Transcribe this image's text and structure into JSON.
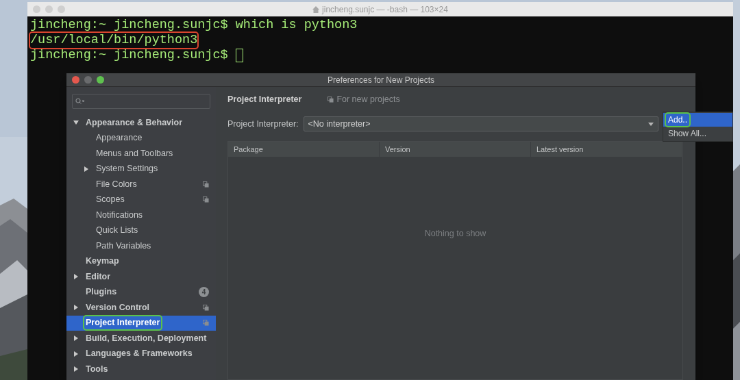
{
  "terminal": {
    "title": "jincheng.sunjc — -bash — 103×24",
    "lines": [
      {
        "text": "jincheng:~ jincheng.sunjc$ which is python3",
        "boxed": false,
        "cursor": false
      },
      {
        "text": "/usr/local/bin/python3",
        "boxed": true,
        "cursor": false
      },
      {
        "text": "jincheng:~ jincheng.sunjc$ ",
        "boxed": false,
        "cursor": true
      }
    ]
  },
  "dialog": {
    "title": "Preferences for New Projects",
    "sidebar": {
      "items": [
        {
          "label": "Appearance & Behavior",
          "expanded": true,
          "selected": false,
          "boxed": false,
          "shared": false,
          "children": [
            {
              "label": "Appearance",
              "selected": false,
              "boxed": false,
              "shared": false
            },
            {
              "label": "Menus and Toolbars",
              "selected": false,
              "boxed": false,
              "shared": false
            },
            {
              "label": "System Settings",
              "expanded": false,
              "selected": false,
              "boxed": false,
              "shared": false
            },
            {
              "label": "File Colors",
              "selected": false,
              "boxed": false,
              "shared": true
            },
            {
              "label": "Scopes",
              "selected": false,
              "boxed": false,
              "shared": true
            },
            {
              "label": "Notifications",
              "selected": false,
              "boxed": false,
              "shared": false
            },
            {
              "label": "Quick Lists",
              "selected": false,
              "boxed": false,
              "shared": false
            },
            {
              "label": "Path Variables",
              "selected": false,
              "boxed": false,
              "shared": false
            }
          ]
        },
        {
          "label": "Keymap",
          "selected": false,
          "boxed": false,
          "shared": false
        },
        {
          "label": "Editor",
          "expanded": false,
          "selected": false,
          "boxed": false,
          "shared": false
        },
        {
          "label": "Plugins",
          "selected": false,
          "boxed": false,
          "shared": false,
          "badge": "4"
        },
        {
          "label": "Version Control",
          "expanded": false,
          "selected": false,
          "boxed": false,
          "shared": true
        },
        {
          "label": "Project Interpreter",
          "selected": true,
          "boxed": true,
          "shared": true
        },
        {
          "label": "Build, Execution, Deployment",
          "expanded": false,
          "selected": false,
          "boxed": false,
          "shared": false
        },
        {
          "label": "Languages & Frameworks",
          "expanded": false,
          "selected": false,
          "boxed": false,
          "shared": false
        },
        {
          "label": "Tools",
          "expanded": false,
          "selected": false,
          "boxed": false,
          "shared": false
        }
      ]
    },
    "page": {
      "title": "Project Interpreter",
      "scope_note": "For new projects",
      "interpreter_label": "Project Interpreter:",
      "interpreter_value": "<No interpreter>",
      "table": {
        "columns": [
          "Package",
          "Version",
          "Latest version"
        ],
        "empty_text": "Nothing to show"
      }
    },
    "menu": {
      "items": [
        {
          "label": "Add..",
          "selected": true,
          "boxed": true
        },
        {
          "label": "Show All...",
          "selected": false,
          "boxed": false
        }
      ]
    }
  }
}
